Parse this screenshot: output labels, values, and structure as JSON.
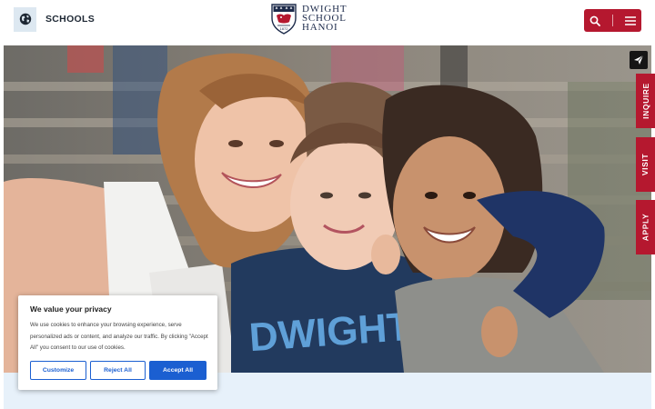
{
  "header": {
    "schools_label": "SCHOOLS",
    "logo_lines": [
      "DWIGHT",
      "SCHOOL",
      "HANOI"
    ],
    "logo_year": "1872",
    "icons": {
      "schools": "globe-icon",
      "search": "search-icon",
      "menu": "hamburger-menu-icon"
    }
  },
  "side_tabs": {
    "share_icon": "paper-plane-icon",
    "inquire": "INQUIRE",
    "visit": "VISIT",
    "apply": "APPLY"
  },
  "hero": {
    "shirt_text": "DWIGHT"
  },
  "cookie": {
    "title": "We value your privacy",
    "text": "We use cookies to enhance your browsing experience, serve personalized ads or content, and analyze our traffic. By clicking \"Accept All\" you consent to our use of cookies.",
    "customize": "Customize",
    "reject": "Reject All",
    "accept": "Accept All"
  },
  "colors": {
    "brand_red": "#b5182f",
    "accept_blue": "#1b5fd1",
    "logo_navy": "#1c2a4a",
    "band_blue": "#e7f1fa"
  }
}
